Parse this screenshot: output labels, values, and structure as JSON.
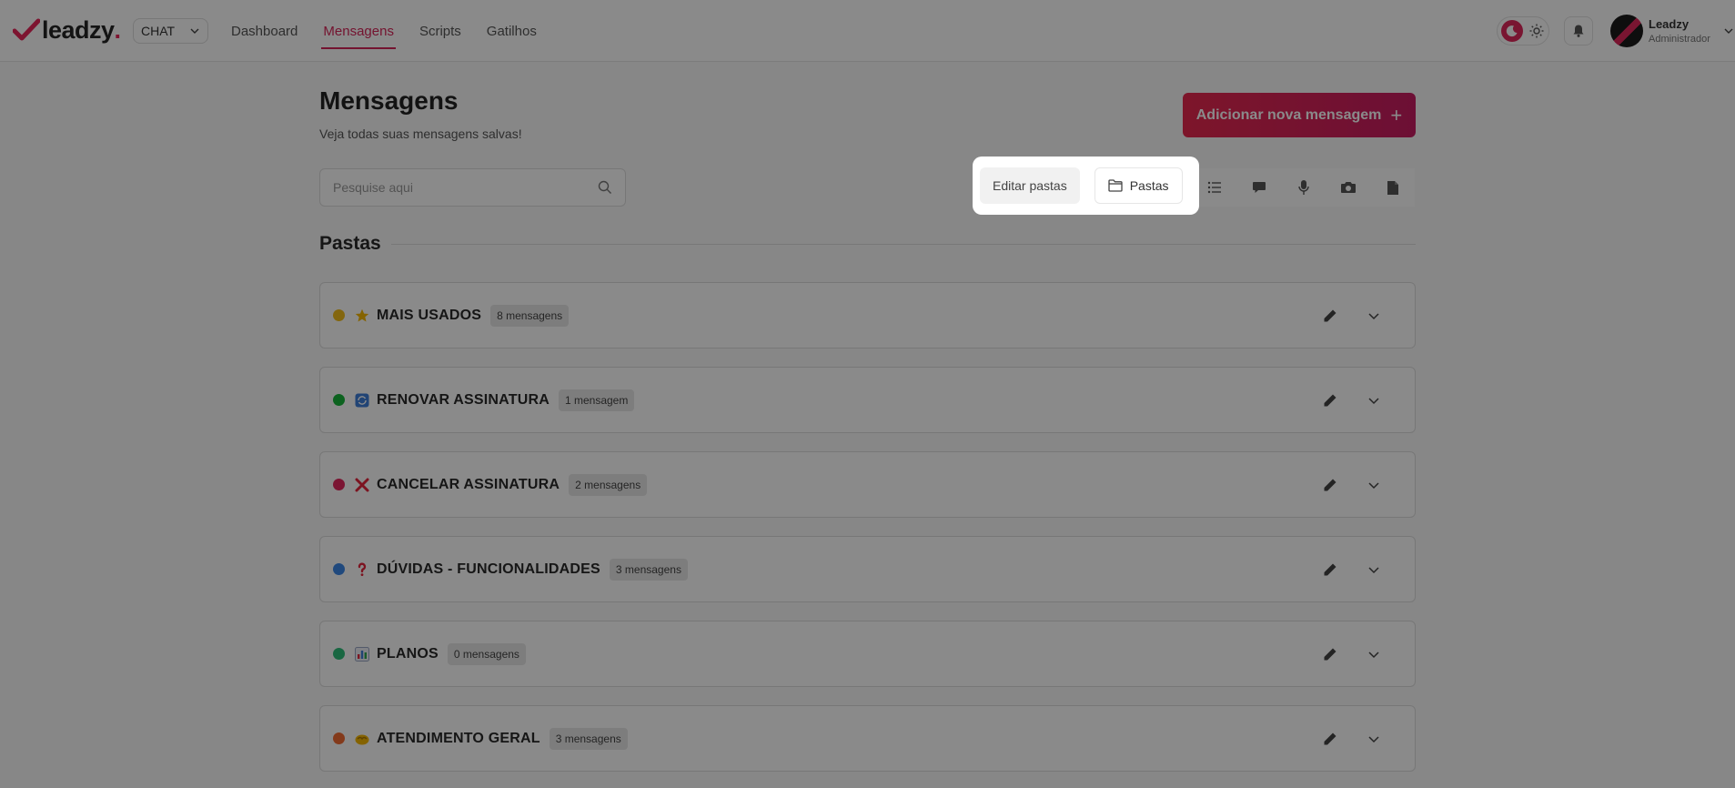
{
  "header": {
    "logo_text": "leadzy",
    "logo_dot": ".",
    "module": "CHAT",
    "nav": [
      {
        "label": "Dashboard",
        "active": false
      },
      {
        "label": "Mensagens",
        "active": true
      },
      {
        "label": "Scripts",
        "active": false
      },
      {
        "label": "Gatilhos",
        "active": false
      }
    ],
    "user": {
      "name": "Leadzy",
      "role": "Administrador"
    }
  },
  "page": {
    "title": "Mensagens",
    "subtitle": "Veja todas suas mensagens salvas!",
    "add_button": "Adicionar nova mensagem",
    "search_placeholder": "Pesquise aqui",
    "edit_folders": "Editar pastas",
    "folders_button": "Pastas",
    "section_title": "Pastas"
  },
  "folders": [
    {
      "name": "MAIS USADOS",
      "count": "8 mensagens",
      "dot": "#f2bd1a",
      "icon": "star-icon"
    },
    {
      "name": "RENOVAR ASSINATURA",
      "count": "1 mensagem",
      "dot": "#17b53a",
      "icon": "renew-icon"
    },
    {
      "name": "CANCELAR ASSINATURA",
      "count": "2 mensagens",
      "dot": "#e3285e",
      "icon": "cross-icon"
    },
    {
      "name": "DÚVIDAS - FUNCIONALIDADES",
      "count": "3 mensagens",
      "dot": "#3c87e8",
      "icon": "question-icon"
    },
    {
      "name": "PLANOS",
      "count": "0 mensagens",
      "dot": "#2fbf7a",
      "icon": "bar-chart-icon"
    },
    {
      "name": "ATENDIMENTO GERAL",
      "count": "3 mensagens",
      "dot": "#f26b33",
      "icon": "handshake-icon"
    }
  ],
  "colors": {
    "accent": "#d72559",
    "overlay": "rgba(0,0,0,0.46)"
  }
}
